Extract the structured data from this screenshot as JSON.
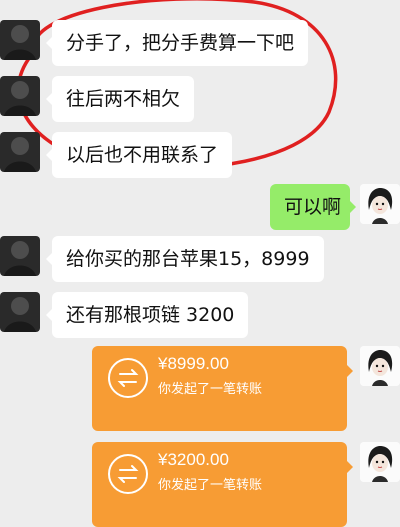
{
  "messages": [
    {
      "side": "left",
      "text": "分手了，把分手费算一下吧"
    },
    {
      "side": "left",
      "text": "往后两不相欠"
    },
    {
      "side": "left",
      "text": "以后也不用联系了"
    },
    {
      "side": "right",
      "text": "可以啊"
    },
    {
      "side": "left",
      "text": "给你买的那台苹果15，8999"
    },
    {
      "side": "left",
      "text": "还有那根项链 3200"
    }
  ],
  "transfers": [
    {
      "amount": "¥8999.00",
      "desc": "你发起了一笔转账"
    },
    {
      "amount": "¥3200.00",
      "desc": "你发起了一笔转账"
    }
  ],
  "colors": {
    "background": "#ededed",
    "bubble_white": "#ffffff",
    "bubble_green": "#95ec69",
    "transfer_orange": "#f79c34",
    "annotation_red": "#e02020"
  },
  "icons": {
    "transfer": "transfer-arrows-icon",
    "avatar_left": "avatar-dark-figure",
    "avatar_right": "avatar-girl-drawing"
  }
}
